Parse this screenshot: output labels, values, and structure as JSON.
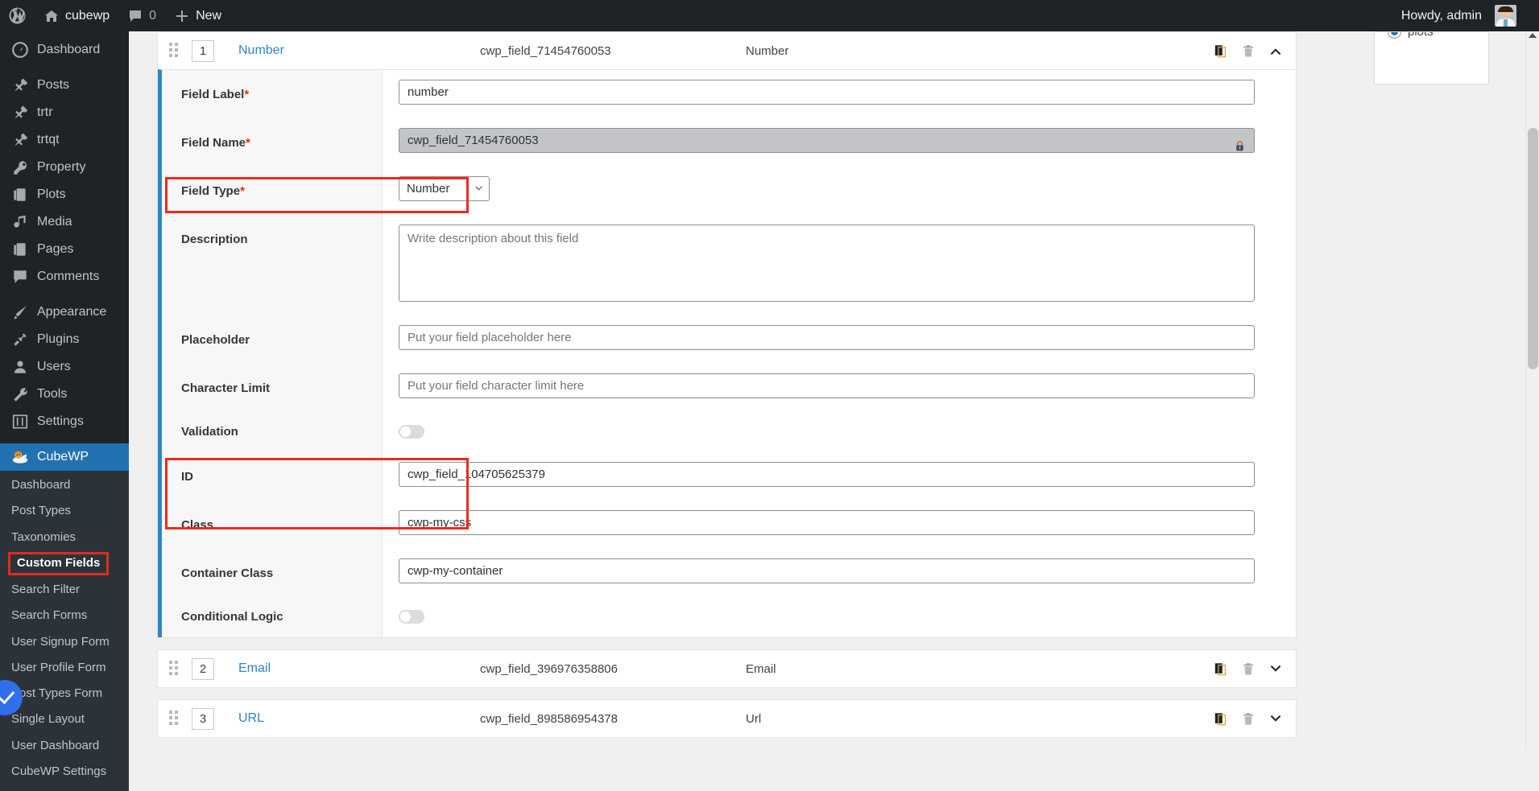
{
  "adminbar": {
    "logo_icon": "wordpress-logo-icon",
    "site_name": "cubewp",
    "site_icon": "home-icon",
    "comments_icon": "comment-bubble-icon",
    "comments_count": "0",
    "new_icon": "plus-icon",
    "new_label": "New",
    "howdy": "Howdy, admin",
    "avatar_alt": "admin-avatar"
  },
  "sidebar": {
    "items": [
      {
        "label": "Dashboard",
        "icon": "dashboard-icon",
        "current": false
      },
      {
        "label": "Posts",
        "icon": "pin-icon",
        "current": false
      },
      {
        "label": "trtr",
        "icon": "pin-icon",
        "current": false
      },
      {
        "label": "trtqt",
        "icon": "pin-icon",
        "current": false
      },
      {
        "label": "Property",
        "icon": "key-icon",
        "current": false
      },
      {
        "label": "Plots",
        "icon": "pages-icon",
        "current": false
      },
      {
        "label": "Media",
        "icon": "media-icon",
        "current": false
      },
      {
        "label": "Pages",
        "icon": "pages-icon",
        "current": false
      },
      {
        "label": "Comments",
        "icon": "comment-bubble-icon",
        "current": false
      },
      {
        "label": "Appearance",
        "icon": "brush-icon",
        "current": false
      },
      {
        "label": "Plugins",
        "icon": "plug-icon",
        "current": false
      },
      {
        "label": "Users",
        "icon": "user-icon",
        "current": false
      },
      {
        "label": "Tools",
        "icon": "wrench-icon",
        "current": false
      },
      {
        "label": "Settings",
        "icon": "sliders-icon",
        "current": false
      },
      {
        "label": "CubeWP",
        "icon": "cubewp-mascot-icon",
        "current": true
      }
    ],
    "submenu": [
      {
        "label": "Dashboard",
        "active": false
      },
      {
        "label": "Post Types",
        "active": false
      },
      {
        "label": "Taxonomies",
        "active": false
      },
      {
        "label": "Custom Fields",
        "active": true
      },
      {
        "label": "Search Filter",
        "active": false
      },
      {
        "label": "Search Forms",
        "active": false
      },
      {
        "label": "User Signup Form",
        "active": false
      },
      {
        "label": "User Profile Form",
        "active": false
      },
      {
        "label": "Post Types Form",
        "active": false
      },
      {
        "label": "Single Layout",
        "active": false
      },
      {
        "label": "User Dashboard",
        "active": false
      },
      {
        "label": "CubeWP Settings",
        "active": false
      }
    ]
  },
  "fields": [
    {
      "order": "1",
      "title": "Number",
      "field_name": "cwp_field_71454760053",
      "type": "Number",
      "expanded": true,
      "copy_icon": "copy-icon",
      "delete_icon": "trash-icon",
      "toggle_icon": "chevron-up-icon"
    },
    {
      "order": "2",
      "title": "Email",
      "field_name": "cwp_field_396976358806",
      "type": "Email",
      "expanded": false,
      "copy_icon": "copy-icon",
      "delete_icon": "trash-icon",
      "toggle_icon": "chevron-down-icon"
    },
    {
      "order": "3",
      "title": "URL",
      "field_name": "cwp_field_898586954378",
      "type": "Url",
      "expanded": false,
      "copy_icon": "copy-icon",
      "delete_icon": "trash-icon",
      "toggle_icon": "chevron-down-icon"
    }
  ],
  "form": {
    "field_label": {
      "label": "Field Label",
      "required": "*",
      "value": "number"
    },
    "field_name": {
      "label": "Field Name",
      "required": "*",
      "value": "cwp_field_71454760053",
      "lock_icon": "lock-icon"
    },
    "field_type": {
      "label": "Field Type",
      "required": "*",
      "value": "Number",
      "chevron_icon": "chevron-down-icon"
    },
    "description": {
      "label": "Description",
      "value": "",
      "placeholder": "Write description about this field"
    },
    "placeholder_row": {
      "label": "Placeholder",
      "value": "",
      "placeholder": "Put your field placeholder here"
    },
    "character_limit": {
      "label": "Character Limit",
      "value": "",
      "placeholder": "Put your field character limit here"
    },
    "validation": {
      "label": "Validation",
      "state": "off"
    },
    "id": {
      "label": "ID",
      "value": "cwp_field_104705625379"
    },
    "class": {
      "label": "Class",
      "value": "cwp-my-css"
    },
    "container_class": {
      "label": "Container Class",
      "value": "cwp-my-container"
    },
    "conditional_logic": {
      "label": "Conditional Logic",
      "state": "off"
    }
  },
  "right_panel": {
    "option_label": "plots",
    "option_checked": true
  },
  "colors": {
    "admin_dark": "#1d2327",
    "submenu_dark": "#2c3338",
    "accent_blue": "#2271b1",
    "link_blue": "#2e86c8",
    "annotation_red": "#ee2a1e",
    "page_bg": "#f0f0f1"
  }
}
